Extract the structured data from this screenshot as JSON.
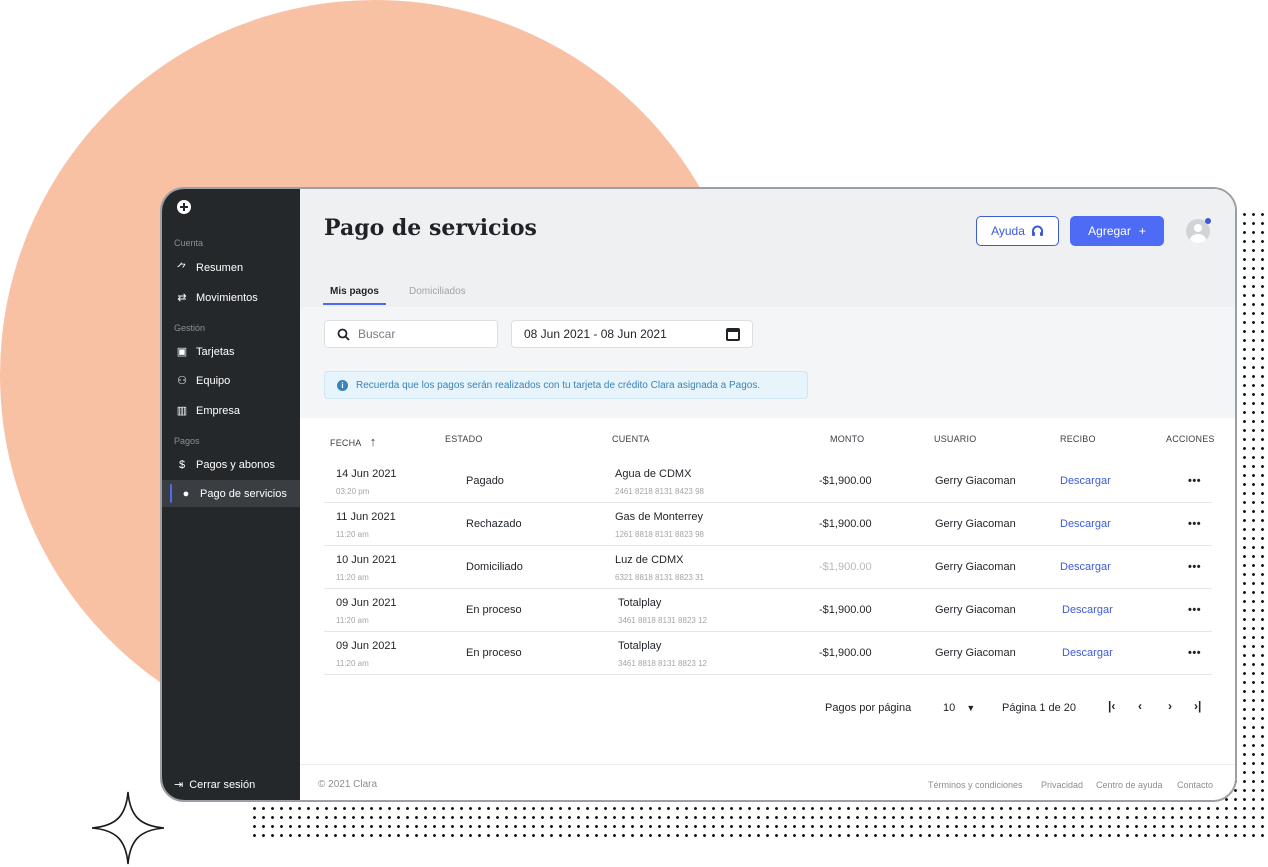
{
  "sidebar": {
    "sections": [
      "Cuenta",
      "Gestión",
      "Pagos"
    ],
    "items": [
      {
        "label": "Resumen",
        "icon": "trend-icon"
      },
      {
        "label": "Movimientos",
        "icon": "transfer-icon"
      },
      {
        "label": "Tarjetas",
        "icon": "card-icon"
      },
      {
        "label": "Equipo",
        "icon": "team-icon"
      },
      {
        "label": "Empresa",
        "icon": "building-icon"
      },
      {
        "label": "Pagos y abonos",
        "icon": "dollar-icon"
      },
      {
        "label": "Pago de servicios",
        "icon": "bulb-icon"
      }
    ],
    "logout": "Cerrar sesión"
  },
  "header": {
    "title": "Pago de servicios",
    "help_label": "Ayuda",
    "add_label": "Agregar",
    "add_symbol": "+"
  },
  "tabs": [
    "Mis pagos",
    "Domiciliados"
  ],
  "filters": {
    "search_placeholder": "Buscar",
    "date_range": "08 Jun 2021 - 08 Jun 2021"
  },
  "info_banner": "Recuerda que los pagos serán realizados con tu tarjeta de crédito Clara asignada a Pagos.",
  "table": {
    "columns": [
      "FECHA",
      "ESTADO",
      "CUENTA",
      "MONTO",
      "USUARIO",
      "RECIBO",
      "ACCIONES"
    ],
    "rows": [
      {
        "date": "14 Jun 2021",
        "time": "03:20 pm",
        "status": "Pagado",
        "account": "Agua de CDMX",
        "account_number": "2461 8218 8131 8423 98",
        "amount": "-$1,900.00",
        "user": "Gerry Giacoman",
        "receipt": "Descargar",
        "actions": "•••"
      },
      {
        "date": "11 Jun 2021",
        "time": "11:20 am",
        "status": "Rechazado",
        "account": "Gas de Monterrey",
        "account_number": "1261 8818 8131 8823 98",
        "amount": "-$1,900.00",
        "user": "Gerry Giacoman",
        "receipt": "Descargar",
        "actions": "•••"
      },
      {
        "date": "10 Jun 2021",
        "time": "11:20 am",
        "status": "Domiciliado",
        "account": "Luz de CDMX",
        "account_number": "6321 8818 8131 8823 31",
        "amount": "-$1,900.00",
        "user": "Gerry Giacoman",
        "receipt": "Descargar",
        "actions": "•••"
      },
      {
        "date": "09 Jun 2021",
        "time": "11:20 am",
        "status": "En proceso",
        "account": "Totalplay",
        "account_number": "3461 8818 8131 8823 12",
        "amount": "-$1,900.00",
        "user": "Gerry Giacoman",
        "receipt": "Descargar",
        "actions": "•••"
      },
      {
        "date": "09 Jun 2021",
        "time": "11:20 am",
        "status": "En proceso",
        "account": "Totalplay",
        "account_number": "3461 8818 8131 8823 12",
        "amount": "-$1,900.00",
        "user": "Gerry Giacoman",
        "receipt": "Descargar",
        "actions": "•••"
      }
    ]
  },
  "pagination": {
    "per_page_label": "Pagos por página",
    "per_page_value": "10",
    "page_label": "Página",
    "page_value": "1 de 20",
    "first": "|‹",
    "prev": "‹",
    "next": "›",
    "last": "›|"
  },
  "footer": {
    "copyright": "© 2021 Clara",
    "links": [
      "Términos y condiciones",
      "Privacidad",
      "Centro de ayuda",
      "Contacto"
    ]
  },
  "colors": {
    "accent": "#4e6bf5",
    "sidebar_bg": "#25282b",
    "background_circle": "#f9c1a3"
  }
}
